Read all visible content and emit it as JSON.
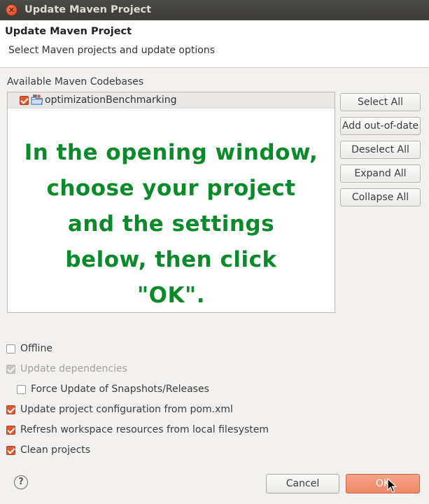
{
  "window": {
    "title": "Update Maven Project"
  },
  "header": {
    "title": "Update Maven Project",
    "description": "Select Maven projects and update options"
  },
  "codebases": {
    "label": "Available Maven Codebases",
    "items": [
      {
        "label": "optimizationBenchmarking",
        "checked": true
      }
    ]
  },
  "overlay": {
    "lines": [
      "In the opening window,",
      "choose your project",
      "and the settings",
      "below, then click",
      "\"OK\"."
    ],
    "color": "#0b8a2b"
  },
  "side_buttons": {
    "select_all": "Select All",
    "add_out_of_date": "Add out-of-date",
    "deselect_all": "Deselect All",
    "expand_all": "Expand All",
    "collapse_all": "Collapse All"
  },
  "options": {
    "offline": {
      "label": "Offline",
      "checked": false,
      "enabled": true
    },
    "update_dependencies": {
      "label": "Update dependencies",
      "checked": true,
      "enabled": false
    },
    "force_update": {
      "label": "Force Update of Snapshots/Releases",
      "checked": false,
      "enabled": true
    },
    "update_config": {
      "label": "Update project configuration from pom.xml",
      "checked": true,
      "enabled": true
    },
    "refresh_workspace": {
      "label": "Refresh workspace resources from local filesystem",
      "checked": true,
      "enabled": true
    },
    "clean_projects": {
      "label": "Clean projects",
      "checked": true,
      "enabled": true
    }
  },
  "footer": {
    "help_icon": "?",
    "cancel_label": "Cancel",
    "ok_label": "OK"
  },
  "colors": {
    "accent": "#e0582d",
    "titlebar": "#3c3b37",
    "overlay_text": "#0b8a2b"
  }
}
